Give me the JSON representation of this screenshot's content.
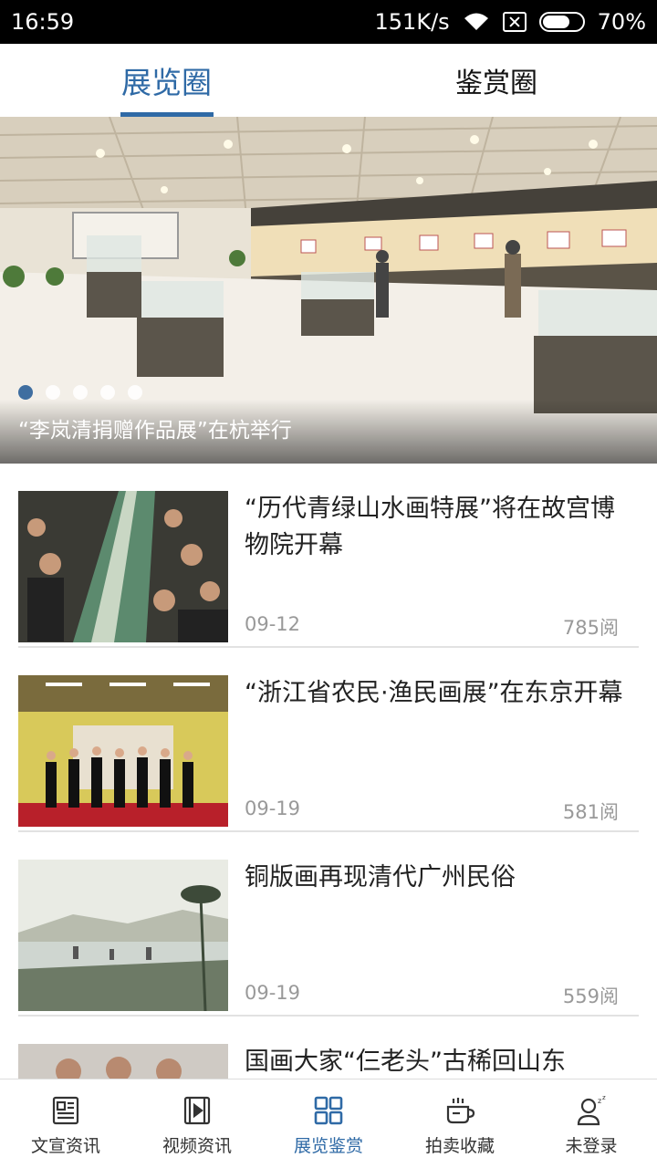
{
  "status_bar": {
    "time": "16:59",
    "speed": "151K/s",
    "battery": "70%",
    "battery_level": 0.7
  },
  "top_tabs": [
    {
      "label": "展览圈",
      "active": true
    },
    {
      "label": "鉴赏圈",
      "active": false
    }
  ],
  "banner": {
    "caption": "“李岚清捐赠作品展”在杭举行",
    "dot_count": 5,
    "active_dot": 0
  },
  "news": [
    {
      "title": "“历代青绿山水画特展”将在故宫博物院开幕",
      "date": "09-12",
      "reads": "785阅",
      "thumb_icon": "exhibition-crowd-photo"
    },
    {
      "title": "“浙江省农民·渔民画展”在东京开幕",
      "date": "09-19",
      "reads": "581阅",
      "thumb_icon": "ribbon-cutting-photo"
    },
    {
      "title": "铜版画再现清代广州民俗",
      "date": "09-19",
      "reads": "559阅",
      "thumb_icon": "copperplate-landscape-photo"
    },
    {
      "title": "国画大家“仨老头”古稀回山东",
      "date": "",
      "reads": "",
      "thumb_icon": "painters-photo"
    }
  ],
  "bottom_nav": [
    {
      "label": "文宣资讯",
      "icon": "newspaper-icon",
      "active": false
    },
    {
      "label": "视频资讯",
      "icon": "video-icon",
      "active": false
    },
    {
      "label": "展览鉴赏",
      "icon": "grid-icon",
      "active": true
    },
    {
      "label": "拍卖收藏",
      "icon": "cup-icon",
      "active": false
    },
    {
      "label": "未登录",
      "icon": "user-sleep-icon",
      "active": false
    }
  ],
  "colors": {
    "accent": "#2f6aa6",
    "text": "#222222",
    "meta": "#999999"
  }
}
